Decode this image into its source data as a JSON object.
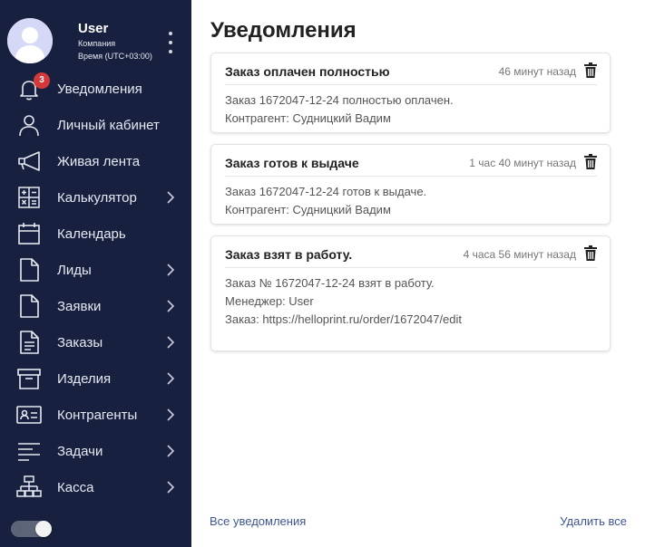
{
  "colors": {
    "sidebar_bg": "#17213f",
    "sidebar_text": "#e6e9f2",
    "badge": "#d4393a",
    "link": "#3f5593",
    "avatar_bg": "#d5d8f6"
  },
  "profile": {
    "name": "User",
    "company": "Компания",
    "time": "Время (UTC+03:00)",
    "menu_icon": "kebab-menu-icon"
  },
  "nav": {
    "items": [
      {
        "label": "Уведомления",
        "icon": "bell-icon",
        "badge": "3"
      },
      {
        "label": "Личный кабинет",
        "icon": "user-icon"
      },
      {
        "label": "Живая лента",
        "icon": "megaphone-icon"
      },
      {
        "label": "Калькулятор",
        "icon": "calculator-icon",
        "chevron": true
      },
      {
        "label": "Календарь",
        "icon": "calendar-icon"
      },
      {
        "label": "Лиды",
        "icon": "file-icon",
        "chevron": true
      },
      {
        "label": "Заявки",
        "icon": "file-icon",
        "chevron": true
      },
      {
        "label": "Заказы",
        "icon": "document-icon",
        "chevron": true
      },
      {
        "label": "Изделия",
        "icon": "archive-box-icon",
        "chevron": true
      },
      {
        "label": "Контрагенты",
        "icon": "contact-card-icon",
        "chevron": true
      },
      {
        "label": "Задачи",
        "icon": "align-left-icon",
        "chevron": true
      },
      {
        "label": "Касса",
        "icon": "sitemap-icon",
        "chevron": true
      }
    ]
  },
  "theme_toggle": {
    "on": true
  },
  "main": {
    "title": "Уведомления",
    "notifications": [
      {
        "title": "Заказ оплачен полностью",
        "time": "46 минут назад",
        "lines": [
          "Заказ 1672047-12-24 полностью оплачен.",
          "Контрагент: Судницкий Вадим"
        ]
      },
      {
        "title": "Заказ готов к выдаче",
        "time": "1 час 40 минут назад",
        "lines": [
          "Заказ 1672047-12-24 готов к выдаче.",
          "Контрагент: Судницкий Вадим"
        ]
      },
      {
        "title": "Заказ взят в работу.",
        "time": "4 часа 56 минут назад",
        "lines": [
          "Заказ № 1672047-12-24 взят в работу.",
          "Менеджер: User",
          "Заказ: https://helloprint.ru/order/1672047/edit"
        ]
      }
    ],
    "footer": {
      "all_label": "Все уведомления",
      "delete_all_label": "Удалить все"
    }
  }
}
